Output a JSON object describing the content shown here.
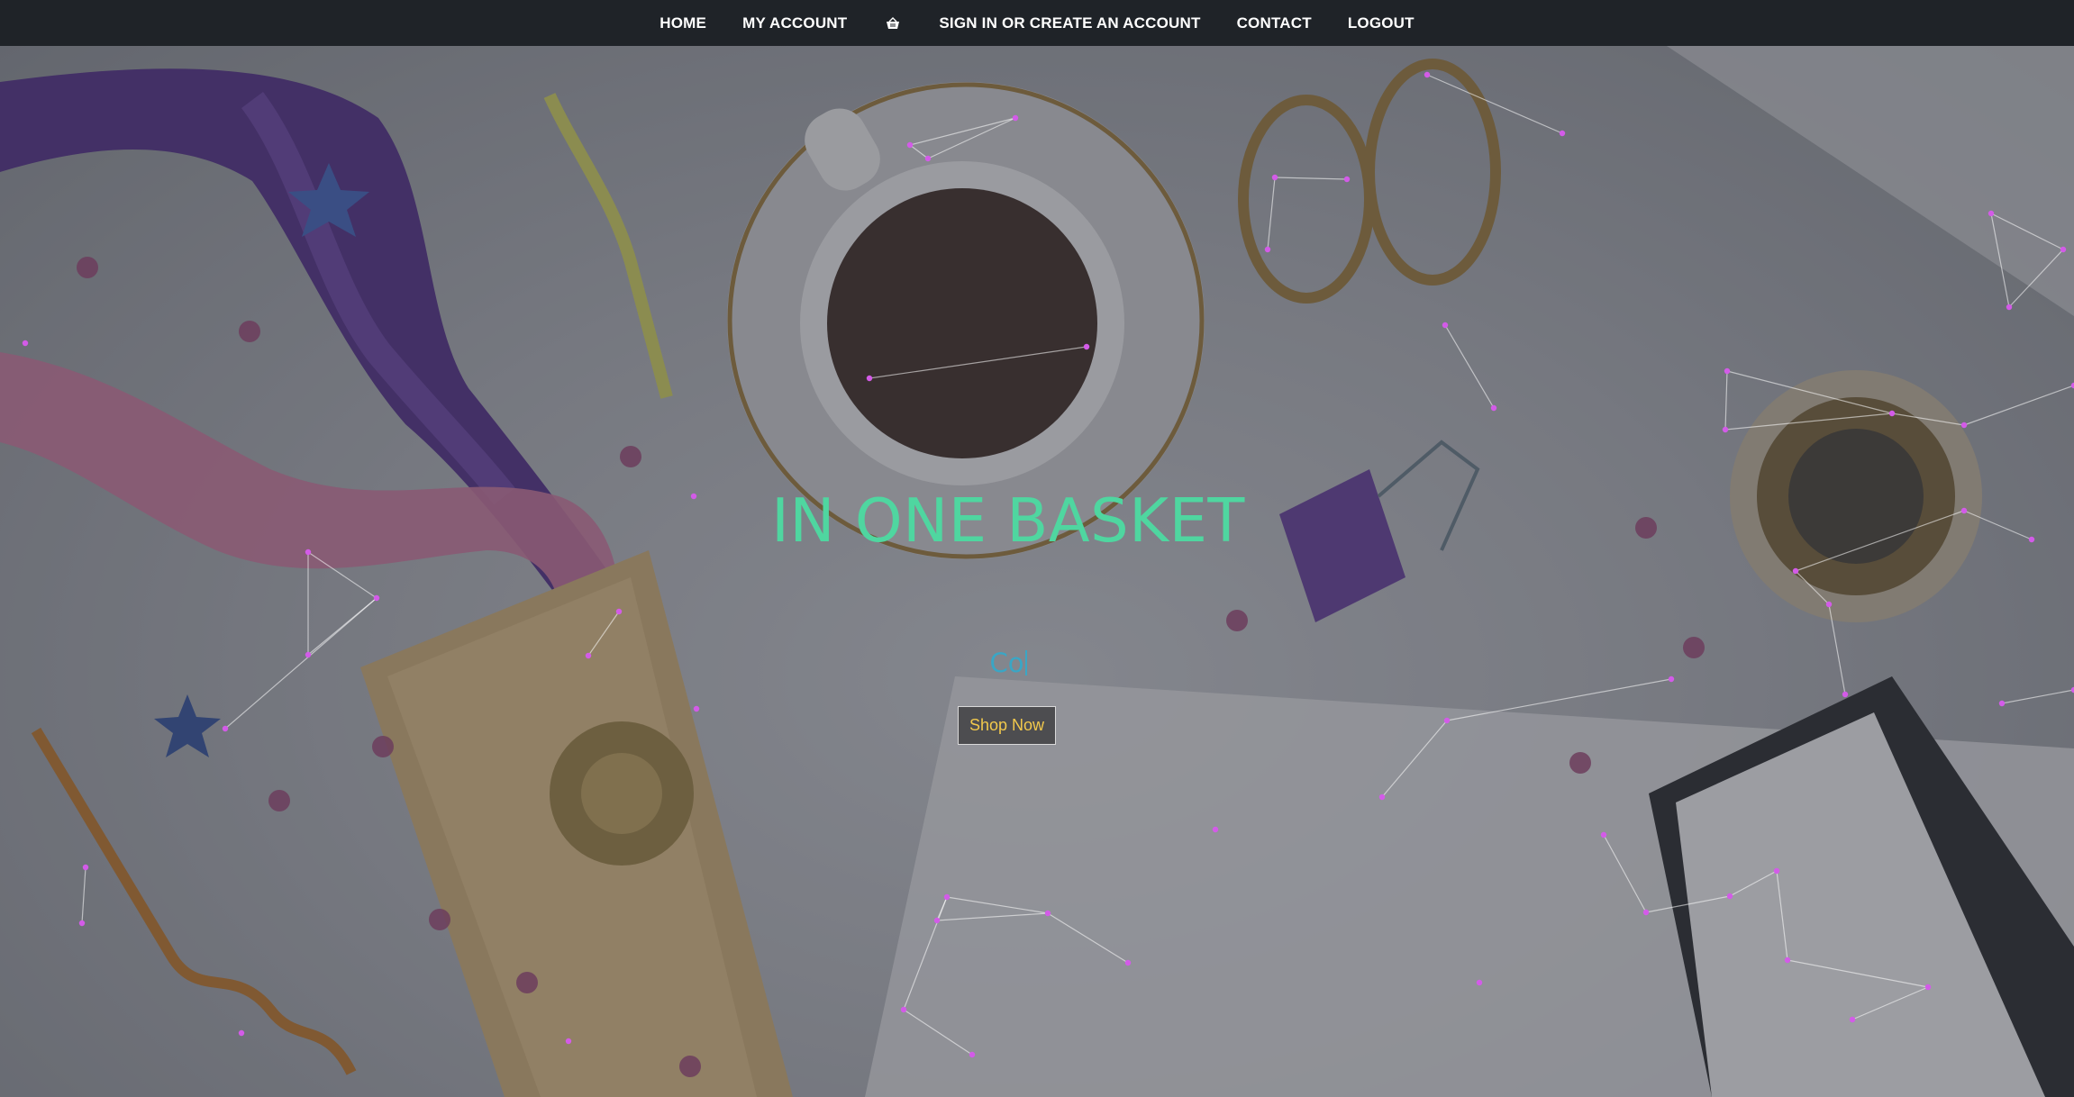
{
  "nav": {
    "items": [
      {
        "label": "HOME"
      },
      {
        "label": "MY ACCOUNT"
      },
      {
        "label": "SIGN IN OR CREATE AN ACCOUNT"
      },
      {
        "label": "CONTACT"
      },
      {
        "label": "LOGOUT"
      }
    ],
    "cart_icon": "basket-icon"
  },
  "hero": {
    "title": "IN ONE BASKET",
    "typed_text": "Co",
    "button_label": "Shop Now"
  },
  "colors": {
    "nav_bg": "#1f2328",
    "title": "#4fd6a0",
    "typed": "#3aa6c5",
    "button_text": "#f2c94c",
    "particles": "#d35be8"
  }
}
